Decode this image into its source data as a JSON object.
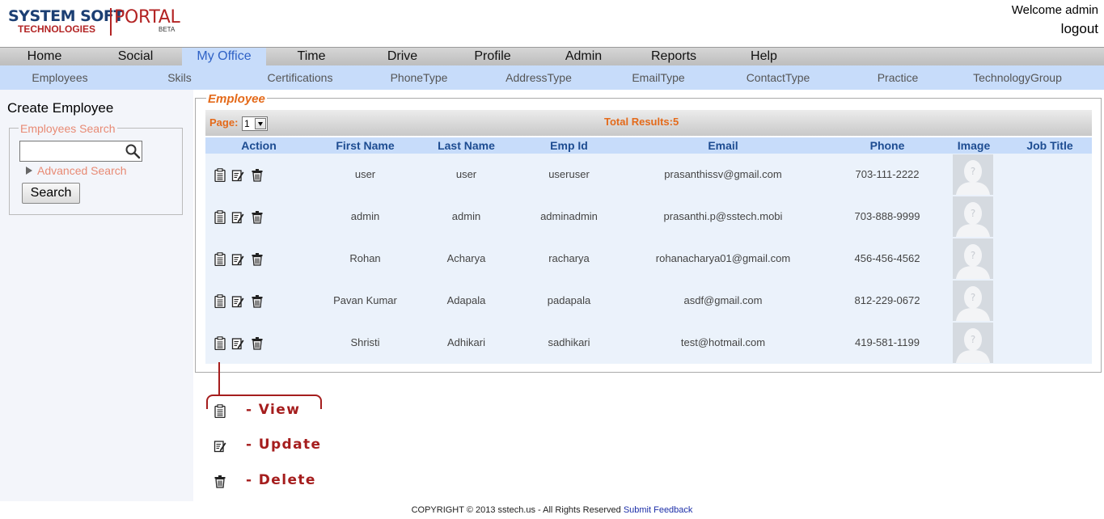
{
  "header": {
    "logo_line1": "SYSTEM SOFT",
    "logo_line2": "TECHNOLOGIES",
    "logo_portal": "PORTAL",
    "logo_beta": "BETA",
    "welcome": "Welcome admin",
    "logout": "logout"
  },
  "nav": {
    "active": "My Office",
    "items": [
      "Home",
      "Social",
      "My Office",
      "Time",
      "Drive",
      "Profile",
      "Admin",
      "Reports",
      "Help"
    ]
  },
  "subnav": {
    "items": [
      "Employees",
      "Skils",
      "Certifications",
      "PhoneType",
      "AddressType",
      "EmailType",
      "ContactType",
      "Practice",
      "TechnologyGroup"
    ]
  },
  "sidebar": {
    "create_employee": "Create Employee",
    "search_legend": "Employees Search",
    "search_value": "",
    "advanced_search": "Advanced Search",
    "search_button": "Search"
  },
  "employee_panel": {
    "legend": "Employee",
    "page_label": "Page:",
    "page_value": "1",
    "total_results": "Total Results:5",
    "columns": [
      "Action",
      "First Name",
      "Last Name",
      "Emp Id",
      "Email",
      "Phone",
      "Image",
      "Job Title"
    ],
    "rows": [
      {
        "first": "user",
        "last": "user",
        "emp_id": "useruser",
        "email": "prasanthissv@gmail.com",
        "phone": "703-111-2222",
        "job_title": ""
      },
      {
        "first": "admin",
        "last": "admin",
        "emp_id": "adminadmin",
        "email": "prasanthi.p@sstech.mobi",
        "phone": "703-888-9999",
        "job_title": ""
      },
      {
        "first": "Rohan",
        "last": "Acharya",
        "emp_id": "racharya",
        "email": "rohanacharya01@gmail.com",
        "phone": "456-456-4562",
        "job_title": ""
      },
      {
        "first": "Pavan Kumar",
        "last": "Adapala",
        "emp_id": "padapala",
        "email": "asdf@gmail.com",
        "phone": "812-229-0672",
        "job_title": ""
      },
      {
        "first": "Shristi",
        "last": "Adhikari",
        "emp_id": "sadhikari",
        "email": "test@hotmail.com",
        "phone": "419-581-1199",
        "job_title": ""
      }
    ]
  },
  "legend_callout": {
    "view": "- View",
    "update": "- Update",
    "delete": "- Delete"
  },
  "footer": {
    "copyright": "COPYRIGHT © 2013 sstech.us - All Rights Reserved",
    "feedback": "Submit Feedback"
  },
  "colors": {
    "brand_blue": "#1c3f73",
    "brand_red": "#b32424",
    "nav_active_bg": "#c7dcfa",
    "accent_orange": "#e46a1a",
    "header_text_blue": "#1d4c91",
    "callout_red": "#a51d1d"
  }
}
